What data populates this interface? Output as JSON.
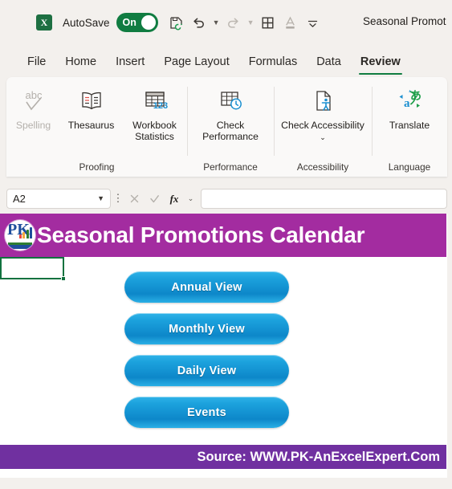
{
  "titlebar": {
    "app_icon": "excel-icon",
    "app_icon_letter": "X",
    "autosave_label": "AutoSave",
    "autosave_state": "On",
    "document_title": "Seasonal Promot",
    "quick_access": [
      {
        "name": "save-icon",
        "label": "Save"
      },
      {
        "name": "undo-icon",
        "label": "Undo"
      },
      {
        "name": "redo-icon",
        "label": "Redo"
      },
      {
        "name": "borders-icon",
        "label": "Borders"
      },
      {
        "name": "font-color-icon",
        "label": "Font Color"
      },
      {
        "name": "customize-quick-access-toolbar-icon",
        "label": "Customize Quick Access Toolbar"
      }
    ]
  },
  "ribbon": {
    "tabs": [
      {
        "label": "File",
        "active": false
      },
      {
        "label": "Home",
        "active": false
      },
      {
        "label": "Insert",
        "active": false
      },
      {
        "label": "Page Layout",
        "active": false
      },
      {
        "label": "Formulas",
        "active": false
      },
      {
        "label": "Data",
        "active": false
      },
      {
        "label": "Review",
        "active": true
      }
    ],
    "groups": [
      {
        "name": "Proofing",
        "items": [
          {
            "label": "Spelling",
            "icon": "spelling-abc-check-icon",
            "disabled": true
          },
          {
            "label": "Thesaurus",
            "icon": "thesaurus-book-icon",
            "disabled": false
          },
          {
            "label": "Workbook Statistics",
            "icon": "workbook-statistics-123-icon",
            "disabled": false
          }
        ]
      },
      {
        "name": "Performance",
        "items": [
          {
            "label": "Check Performance",
            "icon": "check-performance-clock-icon",
            "disabled": false
          }
        ]
      },
      {
        "name": "Accessibility",
        "items": [
          {
            "label": "Check Accessibility",
            "icon": "check-accessibility-person-icon",
            "disabled": false,
            "has_caret": true
          }
        ]
      },
      {
        "name": "Language",
        "items": [
          {
            "label": "Translate",
            "icon": "translate-icon",
            "disabled": false
          }
        ]
      }
    ]
  },
  "formula_bar": {
    "name_box_value": "A2",
    "name_box_caret": "name-box-dropdown-icon",
    "cancel_icon": "cancel-x-icon",
    "enter_icon": "enter-check-icon",
    "function_icon": "insert-function-fx-icon",
    "formula_value": "",
    "formula_placeholder": ""
  },
  "sheet": {
    "banner": {
      "logo_name": "pk-an-excel-expert-logo",
      "logo_text": "PK",
      "title": "Seasonal Promotions Calendar",
      "background_color": "#a32ca0",
      "text_color": "#ffffff",
      "logo_bars": [
        {
          "color": "#e8453c",
          "height": 5
        },
        {
          "color": "#f2a93b",
          "height": 8
        },
        {
          "color": "#2f7d32",
          "height": 11
        },
        {
          "color": "#1f4e9c",
          "height": 14
        }
      ]
    },
    "selected_cell": "A2",
    "nav_buttons": [
      {
        "label": "Annual View"
      },
      {
        "label": "Monthly View"
      },
      {
        "label": "Daily View"
      },
      {
        "label": "Events"
      }
    ],
    "footer": {
      "source_text": "Source: WWW.PK-AnExcelExpert.Com",
      "background_color": "#7030a0",
      "text_color": "#ffffff"
    },
    "button_gradient_top": "#2fb3e8",
    "button_gradient_bottom": "#0d87c9"
  }
}
